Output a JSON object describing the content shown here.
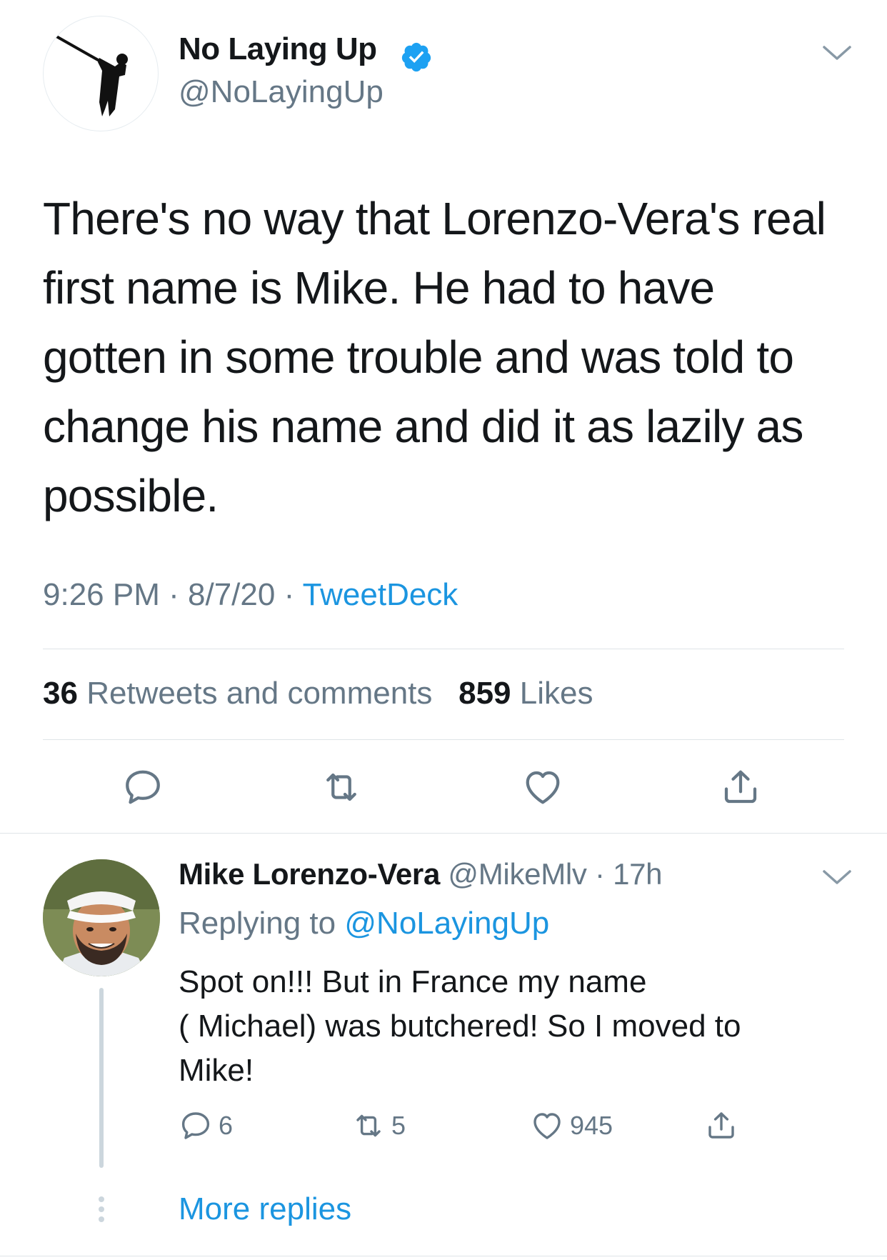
{
  "tweet": {
    "author_name": "No Laying Up",
    "author_handle": "@NoLayingUp",
    "text": "There's no way that Lorenzo-Vera's real first name is Mike. He had to have gotten in some trouble and was told to change his name and did it as lazily as possible.",
    "time": "9:26 PM",
    "date": "8/7/20",
    "source": "TweetDeck",
    "retweets_count": "36",
    "retweets_label": "Retweets and comments",
    "likes_count": "859",
    "likes_label": "Likes"
  },
  "reply": {
    "author_name": "Mike Lorenzo-Vera",
    "author_handle": "@MikeMlv",
    "age": "17h",
    "replying_prefix": "Replying to",
    "replying_to": "@NoLayingUp",
    "text_line1": "Spot on!!! But in France my name",
    "text_line2": "( Michael) was butchered! So I moved to",
    "text_line3": "Mike!",
    "reply_count": "6",
    "retweet_count": "5",
    "like_count": "945"
  },
  "thread": {
    "more_replies": "More replies"
  },
  "colors": {
    "link_blue": "#1b95e0",
    "secondary_gray": "#657786",
    "divider": "#dfe4e8"
  },
  "icons": [
    "verified-badge-icon",
    "chevron-down-icon",
    "comment-icon",
    "retweet-icon",
    "heart-icon",
    "share-icon"
  ]
}
